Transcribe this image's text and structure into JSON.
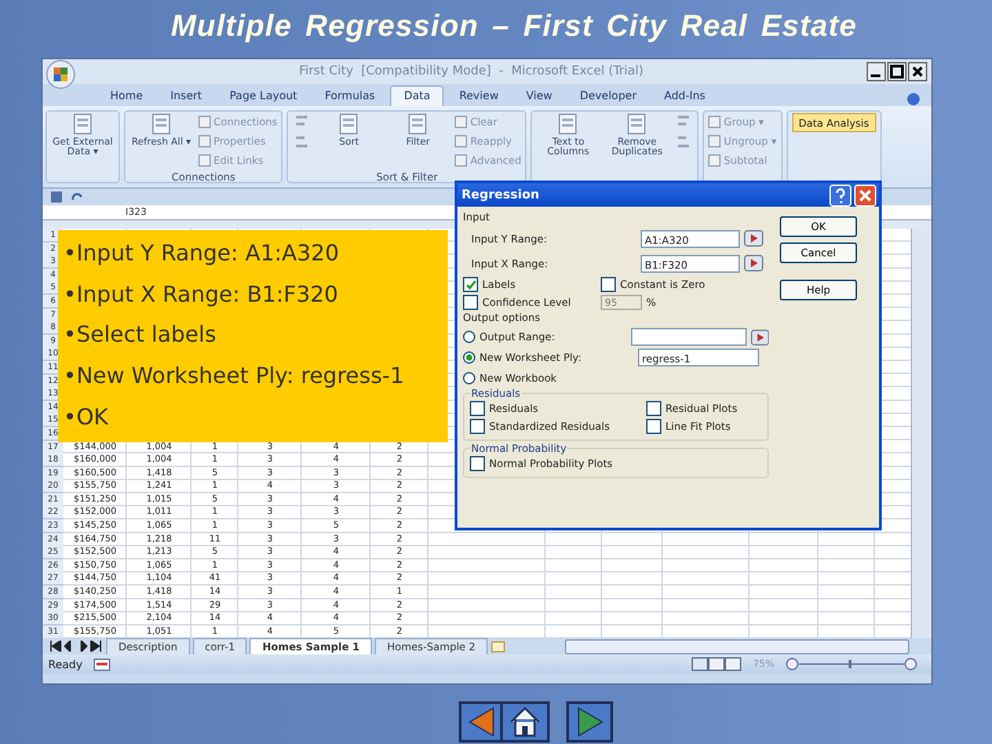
{
  "title": "Multiple Regression – First City Real Estate",
  "excel": {
    "window_title": "First City  [Compatibility Mode]  -  Microsoft Excel (Trial)",
    "tabs": [
      {
        "label": "Home",
        "selected": false
      },
      {
        "label": "Insert",
        "selected": false
      },
      {
        "label": "Page Layout",
        "selected": false
      },
      {
        "label": "Formulas",
        "selected": false
      },
      {
        "label": "Data",
        "selected": true
      },
      {
        "label": "Review",
        "selected": false
      },
      {
        "label": "View",
        "selected": false
      },
      {
        "label": "Developer",
        "selected": false
      },
      {
        "label": "Add-Ins",
        "selected": false
      }
    ],
    "ribbon_groups": [
      {
        "items": [
          {
            "kind": "large",
            "label": "Get External Data ▾"
          }
        ]
      },
      {
        "label": "Connections",
        "items": [
          {
            "kind": "large",
            "label": "Refresh All ▾"
          },
          {
            "kind": "small",
            "label": "Connections"
          },
          {
            "kind": "small",
            "label": "Properties"
          },
          {
            "kind": "small",
            "label": "Edit Links"
          }
        ]
      },
      {
        "label": "Sort & Filter",
        "items": [
          {
            "kind": "icon"
          },
          {
            "kind": "large",
            "label": "Sort"
          },
          {
            "kind": "large",
            "label": "Filter"
          },
          {
            "kind": "small",
            "label": "Clear"
          },
          {
            "kind": "small",
            "label": "Reapply"
          },
          {
            "kind": "small",
            "label": "Advanced"
          }
        ]
      },
      {
        "items": [
          {
            "kind": "large",
            "label": "Text to Columns"
          },
          {
            "kind": "large",
            "label": "Remove Duplicates"
          },
          {
            "kind": "icon"
          }
        ]
      },
      {
        "items": [
          {
            "kind": "small",
            "label": "Group ▾"
          },
          {
            "kind": "small",
            "label": "Ungroup ▾"
          },
          {
            "kind": "small",
            "label": "Subtotal"
          }
        ]
      },
      {
        "items": [
          {
            "kind": "highlight",
            "label": "Data Analysis"
          }
        ]
      }
    ],
    "name_box": "I323",
    "row_numbers": [
      "1",
      "2",
      "3",
      "4",
      "5",
      "6",
      "7",
      "8",
      "9",
      "10",
      "11",
      "12",
      "13",
      "14",
      "15",
      "16"
    ],
    "rows": [
      {
        "number": "17",
        "cells": [
          "$144,000",
          "1,004",
          "1",
          "3",
          "4",
          "2"
        ]
      },
      {
        "number": "18",
        "cells": [
          "$160,000",
          "1,004",
          "1",
          "3",
          "4",
          "2"
        ]
      },
      {
        "number": "19",
        "cells": [
          "$160,500",
          "1,418",
          "5",
          "3",
          "3",
          "2"
        ]
      },
      {
        "number": "20",
        "cells": [
          "$155,750",
          "1,241",
          "1",
          "4",
          "3",
          "2"
        ]
      },
      {
        "number": "21",
        "cells": [
          "$151,250",
          "1,015",
          "5",
          "3",
          "4",
          "2"
        ]
      },
      {
        "number": "22",
        "cells": [
          "$152,000",
          "1,011",
          "1",
          "3",
          "3",
          "2"
        ]
      },
      {
        "number": "23",
        "cells": [
          "$145,250",
          "1,065",
          "1",
          "3",
          "5",
          "2"
        ]
      },
      {
        "number": "24",
        "cells": [
          "$164,750",
          "1,218",
          "11",
          "3",
          "3",
          "2"
        ]
      },
      {
        "number": "25",
        "cells": [
          "$152,500",
          "1,213",
          "5",
          "3",
          "4",
          "2"
        ]
      },
      {
        "number": "26",
        "cells": [
          "$150,750",
          "1,065",
          "1",
          "3",
          "4",
          "2"
        ]
      },
      {
        "number": "27",
        "cells": [
          "$144,750",
          "1,104",
          "41",
          "3",
          "4",
          "2"
        ]
      },
      {
        "number": "28",
        "cells": [
          "$140,250",
          "1,418",
          "14",
          "3",
          "4",
          "1"
        ]
      },
      {
        "number": "29",
        "cells": [
          "$174,500",
          "1,514",
          "29",
          "3",
          "4",
          "2"
        ]
      },
      {
        "number": "30",
        "cells": [
          "$215,500",
          "2,104",
          "14",
          "4",
          "4",
          "2"
        ]
      },
      {
        "number": "31",
        "cells": [
          "$155,750",
          "1,051",
          "1",
          "4",
          "5",
          "2"
        ]
      }
    ],
    "sheet_tabs": [
      {
        "label": "Description",
        "selected": false
      },
      {
        "label": "corr-1",
        "selected": false
      },
      {
        "label": "Homes Sample 1",
        "selected": true
      },
      {
        "label": "Homes-Sample 2",
        "selected": false
      }
    ],
    "status": "Ready",
    "zoom": "75%"
  },
  "dialog": {
    "title": "Regression",
    "input_label": "Input",
    "fields": [
      {
        "label": "Input Y Range:",
        "value": "A1:A320"
      },
      {
        "label": "Input X Range:",
        "value": "B1:F320"
      }
    ],
    "labels": {
      "label": "Labels",
      "checked": true
    },
    "constant_zero": {
      "label": "Constant is Zero",
      "checked": false
    },
    "confidence": {
      "label": "Confidence Level",
      "checked": false,
      "value": "95",
      "unit": "%"
    },
    "output_label": "Output options",
    "outputs": [
      {
        "kind": "field",
        "label": "Output Range:",
        "selected": false
      },
      {
        "kind": "field",
        "label": "New Worksheet Ply:",
        "selected": true,
        "value": "regress-1"
      },
      {
        "kind": "plain",
        "label": "New Workbook",
        "selected": false
      }
    ],
    "residuals_label": "Residuals",
    "residuals": [
      {
        "label": "Residuals",
        "checked": false
      },
      {
        "label": "Residual Plots",
        "checked": false
      },
      {
        "label": "Standardized Residuals",
        "checked": false
      },
      {
        "label": "Line Fit Plots",
        "checked": false
      }
    ],
    "normal_label": "Normal Probability",
    "normal": {
      "label": "Normal Probability Plots",
      "checked": false
    },
    "buttons": [
      "OK",
      "Cancel",
      "Help"
    ]
  },
  "notes": [
    "•Input Y Range: A1:A320",
    "•Input X Range: B1:F320",
    "•Select labels",
    "•New Worksheet Ply: regress-1",
    "•OK"
  ]
}
